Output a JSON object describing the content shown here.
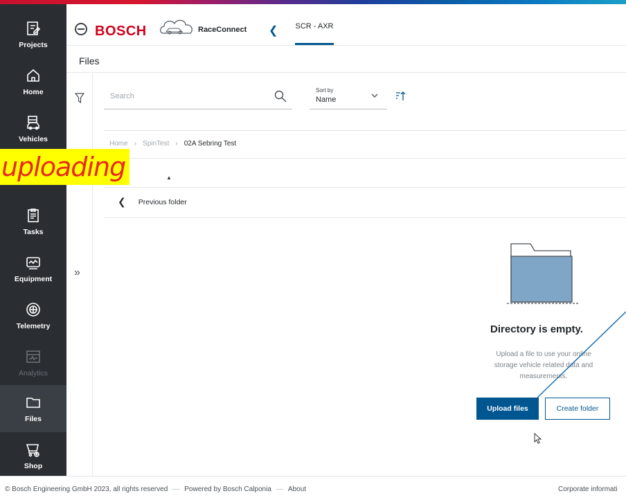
{
  "colors": {
    "brand_red": "#d0021b",
    "accent_blue": "#005691",
    "sidebar_bg": "#2a2e33",
    "annotation_bg": "#ffff00",
    "annotation_text": "#e8281c"
  },
  "sidebar": {
    "items": [
      {
        "label": "Projects",
        "icon": "projects-icon",
        "state": "normal"
      },
      {
        "label": "Home",
        "icon": "home-icon",
        "state": "normal"
      },
      {
        "label": "Vehicles",
        "icon": "vehicles-icon",
        "state": "normal"
      },
      {
        "label": "Tasks",
        "icon": "tasks-icon",
        "state": "normal"
      },
      {
        "label": "Equipment",
        "icon": "equipment-icon",
        "state": "normal"
      },
      {
        "label": "Telemetry",
        "icon": "telemetry-icon",
        "state": "normal"
      },
      {
        "label": "Analytics",
        "icon": "analytics-icon",
        "state": "disabled"
      },
      {
        "label": "Files",
        "icon": "folder-icon",
        "state": "active"
      },
      {
        "label": "Shop",
        "icon": "cart-icon",
        "state": "normal"
      }
    ]
  },
  "header": {
    "brand": "BOSCH",
    "app_name": "RaceConnect",
    "active_tab": "SCR - AXR"
  },
  "page": {
    "title": "Files"
  },
  "search": {
    "placeholder": "Search",
    "value": ""
  },
  "sort": {
    "label": "Sort by",
    "value": "Name"
  },
  "breadcrumb": [
    {
      "label": "Home"
    },
    {
      "label": "SpinTest"
    },
    {
      "label": "02A Sebring Test"
    }
  ],
  "previous_folder": "Previous folder",
  "empty_state": {
    "title": "Directory is empty.",
    "description": "Upload a file to use your online storage vehicle related data and measurements.",
    "primary_button": "Upload files",
    "secondary_button": "Create folder"
  },
  "annotation": {
    "label": "uploading"
  },
  "footer": {
    "copyright": "© Bosch Engineering GmbH 2023, all rights reserved",
    "powered_by": "Powered by Bosch Calponia",
    "about": "About",
    "corporate": "Corporate informati"
  }
}
